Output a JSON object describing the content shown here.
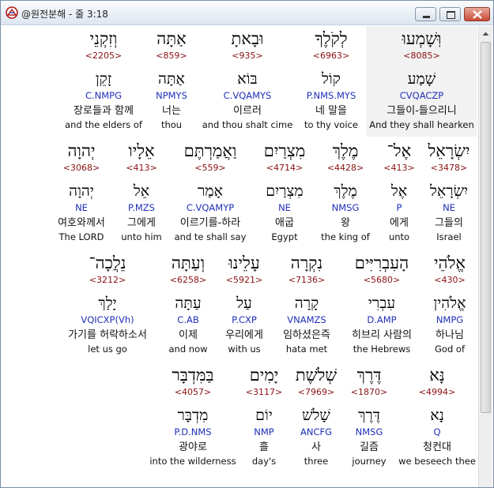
{
  "window": {
    "title": "@원전분해 - 줄 3:18"
  },
  "rows": [
    {
      "words": [
        {
          "heb": "וּֽשָׁמְעוּ",
          "strong": "<8085>",
          "lemma": "שָׁמַע",
          "parse": "CVQACZP",
          "kor": "그들이-들으리니",
          "eng": "And they shall hearken",
          "highlight": true
        },
        {
          "heb": "לְקֹלֶךָ",
          "strong": "<6963>",
          "lemma": "קוֹל",
          "parse": "P.NMS.MYS",
          "kor": "네 말을",
          "eng": "to thy voice"
        },
        {
          "heb": "וּבָאתָ",
          "strong": "<935>",
          "lemma": "בּוֹא",
          "parse": "C.VQAMYS",
          "kor": "이르러",
          "eng": "and thou shalt cime"
        },
        {
          "heb": "אַתָּה",
          "strong": "<859>",
          "lemma": "אַתָּה",
          "parse": "NPMYS",
          "kor": "너는",
          "eng": "thou"
        },
        {
          "heb": "וְזִקְנֵי",
          "strong": "<2205>",
          "lemma": "זָקֵן",
          "parse": "C.NMPG",
          "kor": "장로들과 함께",
          "eng": "and the elders of"
        }
      ]
    },
    {
      "words": [
        {
          "heb": "יִשְׂרָאֵל",
          "strong": "<3478>",
          "lemma": "יִשְׂרָאֵל",
          "parse": "NE",
          "kor": "그들의",
          "eng": "Israel"
        },
        {
          "heb": "אֶל־",
          "strong": "<413>",
          "lemma": "אֶל",
          "parse": "P",
          "kor": "에게",
          "eng": "unto"
        },
        {
          "heb": "מֶלֶךְ",
          "strong": "<4428>",
          "lemma": "מֶלֶךְ",
          "parse": "NMSG",
          "kor": "왕",
          "eng": "the king of"
        },
        {
          "heb": "מִצְרַיִם",
          "strong": "<4714>",
          "lemma": "מִצְרַיִם",
          "parse": "NE",
          "kor": "애굽",
          "eng": "Egypt"
        },
        {
          "heb": "וַאֲמַרְתֶּם",
          "strong": "<559>",
          "lemma": "אָמַר",
          "parse": "C.VQAMYP",
          "kor": "이르기를-하라",
          "eng": "and te shall say"
        },
        {
          "heb": "אֵלָיו",
          "strong": "<413>",
          "lemma": "אֵל",
          "parse": "P.MZS",
          "kor": "그에게",
          "eng": "unto him"
        },
        {
          "heb": "יְהוָה",
          "strong": "<3068>",
          "lemma": "יְהוָה",
          "parse": "NE",
          "kor": "여호와께서",
          "eng": "The LORD"
        }
      ]
    },
    {
      "words": [
        {
          "heb": "אֱלֹהֵי",
          "strong": "<430>",
          "lemma": "אֱלֹהִין",
          "parse": "NMPG",
          "kor": "하나님",
          "eng": "God of"
        },
        {
          "heb": "הָעִבְרִיִּים",
          "strong": "<5680>",
          "lemma": "עִבְרִי",
          "parse": "D.AMP",
          "kor": "히브리 사람의",
          "eng": "the Hebrews"
        },
        {
          "heb": "נִקְרָה",
          "strong": "<7136>",
          "lemma": "קָרָה",
          "parse": "VNAMZS",
          "kor": "임하셨은즉",
          "eng": "hata met"
        },
        {
          "heb": "עָלֵינוּ",
          "strong": "<5921>",
          "lemma": "עַל",
          "parse": "P.CXP",
          "kor": "우리에게",
          "eng": "with us"
        },
        {
          "heb": "וְעַתָּה",
          "strong": "<6258>",
          "lemma": "עַתָּה",
          "parse": "C.AB",
          "kor": "이제",
          "eng": "and now"
        },
        {
          "heb": "נֵלֲכָה־",
          "strong": "<3212>",
          "lemma": "יָלַךְ",
          "parse": "VQICXP(Vh)",
          "kor": "가기를 허락하소서",
          "eng": "let us go"
        }
      ]
    },
    {
      "words": [
        {
          "heb": "נָּא",
          "strong": "<4994>",
          "lemma": "נָא",
          "parse": "Q",
          "kor": "청컨대",
          "eng": "we beseech thee"
        },
        {
          "heb": "דֶּרֶךְ",
          "strong": "<1870>",
          "lemma": "דֶּרֶךְ",
          "parse": "NMSG",
          "kor": "길즘",
          "eng": "journey"
        },
        {
          "heb": "שְׁלֹשֶׁת",
          "strong": "<7969>",
          "lemma": "שָׁלֹשׁ",
          "parse": "ANCFG",
          "kor": "사",
          "eng": "three"
        },
        {
          "heb": "יָמִים",
          "strong": "<3117>",
          "lemma": "יוֹם",
          "parse": "NMP",
          "kor": "흘",
          "eng": "day's"
        },
        {
          "heb": "בַּמִּדְבָּר",
          "strong": "<4057>",
          "lemma": "מִדְבָּר",
          "parse": "P.D.NMS",
          "kor": "광야로",
          "eng": "into the wilderness"
        }
      ]
    }
  ]
}
